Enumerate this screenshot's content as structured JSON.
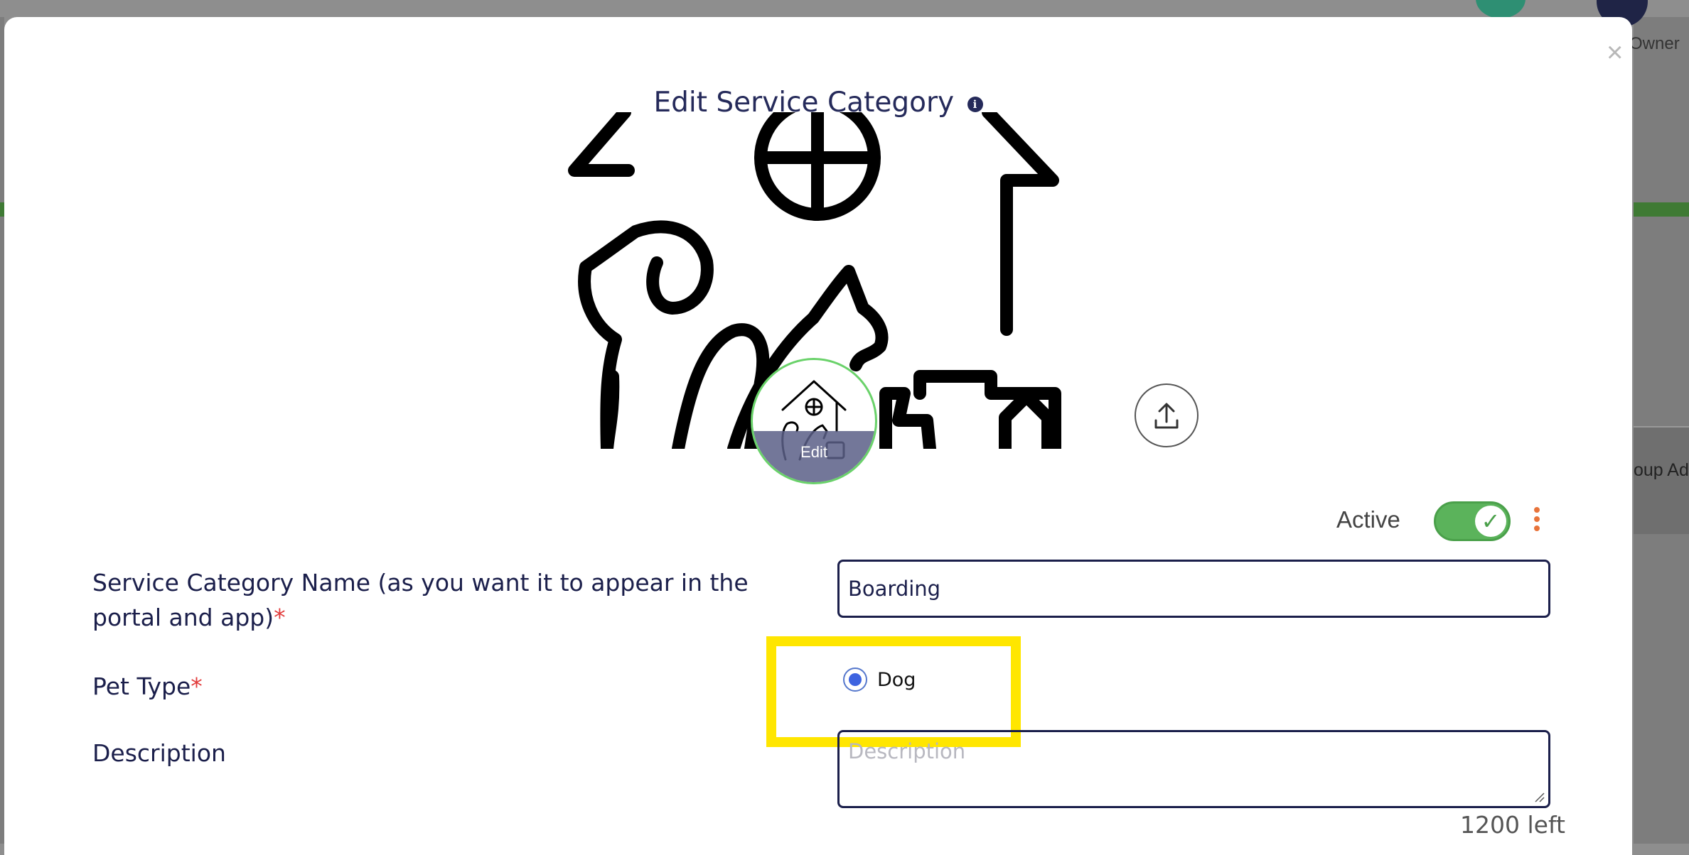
{
  "background": {
    "owner_text": "Owner",
    "panel_text": "oup Ad"
  },
  "modal": {
    "title": "Edit Service Category",
    "info_icon_glyph": "i",
    "close_glyph": "×",
    "image_edit_label": "Edit",
    "status": {
      "label": "Active",
      "enabled": true,
      "check_glyph": "✓"
    },
    "fields": {
      "name": {
        "label": "Service Category Name (as you want it to appear in the portal and app)",
        "required_marker": "*",
        "value": "Boarding"
      },
      "pet_type": {
        "label": "Pet Type",
        "required_marker": "*",
        "options": [
          {
            "label": "Dog",
            "selected": true
          }
        ]
      },
      "description": {
        "label": "Description",
        "placeholder": "Description",
        "value": "",
        "counter": "1200 left"
      }
    }
  },
  "colors": {
    "title": "#252a5a",
    "required": "#e23b3b",
    "toggle_on": "#5bb35b",
    "highlight": "#ffe600",
    "kebab": "#e8733a"
  }
}
